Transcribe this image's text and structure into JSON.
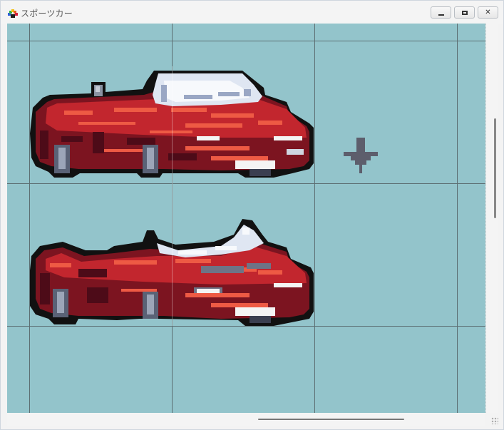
{
  "window": {
    "title": "スポーツカー",
    "buttons": {
      "minimize": "minimize",
      "maximize": "maximize",
      "close": "✕"
    }
  },
  "canvas": {
    "background": "#93c4cb",
    "grid_color": "#5c6e72",
    "arrow_color": "#5d5e6c",
    "sprites": [
      {
        "name": "car-roof-up"
      },
      {
        "name": "car-roof-folding"
      }
    ],
    "arrow_icon": "down-arrow-icon"
  }
}
